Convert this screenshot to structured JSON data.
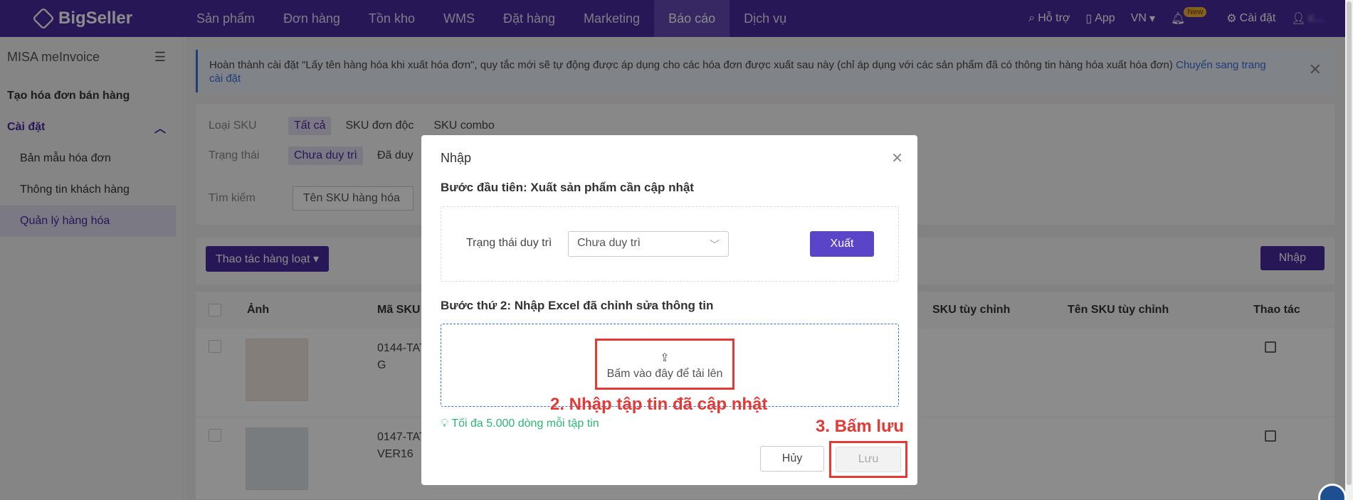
{
  "nav": {
    "logo": "BigSeller",
    "menu": [
      "Sản phẩm",
      "Đơn hàng",
      "Tồn kho",
      "WMS",
      "Đặt hàng",
      "Marketing",
      "Báo cáo",
      "Dịch vụ"
    ],
    "active_index": 6,
    "help": "Hỗ trợ",
    "app": "App",
    "lang": "VN",
    "new_badge": "New",
    "settings": "Cài đặt",
    "user": "c..."
  },
  "sidebar": {
    "title": "MISA meInvoice",
    "create_invoice": "Tạo hóa đơn bán hàng",
    "settings_group": "Cài đặt",
    "items": [
      "Bản mẫu hóa đơn",
      "Thông tin khách hàng",
      "Quản lý hàng hóa"
    ]
  },
  "notice": {
    "text": "Hoàn thành cài đặt \"Lấy tên hàng hóa khi xuất hóa đơn\", quy tắc mới sẽ tự động được áp dụng cho các hóa đơn được xuất sau này (chỉ áp dụng với các sản phẩm đã có thông tin hàng hóa xuất hóa đơn)",
    "link": "Chuyển sang trang cài đặt"
  },
  "filters": {
    "sku_type_label": "Loại SKU",
    "sku_types": [
      "Tất cả",
      "SKU đơn độc",
      "SKU combo"
    ],
    "status_label": "Trạng thái",
    "statuses": [
      "Chưa duy trì",
      "Đã duy"
    ],
    "search_label": "Tìm kiếm",
    "search_field": "Tên SKU hàng hóa"
  },
  "actions": {
    "bulk": "Thao tác hàng loạt",
    "import": "Nhập"
  },
  "table": {
    "headers": [
      "Ảnh",
      "Mã SKU",
      "SKU tùy chỉnh",
      "Tên SKU tùy chỉnh",
      "Thao tác"
    ],
    "rows": [
      {
        "sku": "0144-TAT",
        "sku2": "G"
      },
      {
        "sku": "0147-TAT",
        "sku2": "VER16"
      }
    ]
  },
  "modal": {
    "title": "Nhập",
    "step1": "Bước đầu tiên: Xuất sản phẩm cần cập nhật",
    "status_label": "Trạng thái duy trì",
    "status_value": "Chưa duy trì",
    "export_button": "Xuất",
    "step2": "Bước thứ 2: Nhập Excel đã chỉnh sửa thông tin",
    "upload_text": "Bấm vào đây để tải lên",
    "annotation_upload": "2. Nhập tập tin đã cập nhật",
    "hint": "Tối đa 5.000 dòng mỗi tập tin",
    "annotation_save": "3. Bấm lưu",
    "cancel": "Hủy",
    "save": "Lưu"
  }
}
